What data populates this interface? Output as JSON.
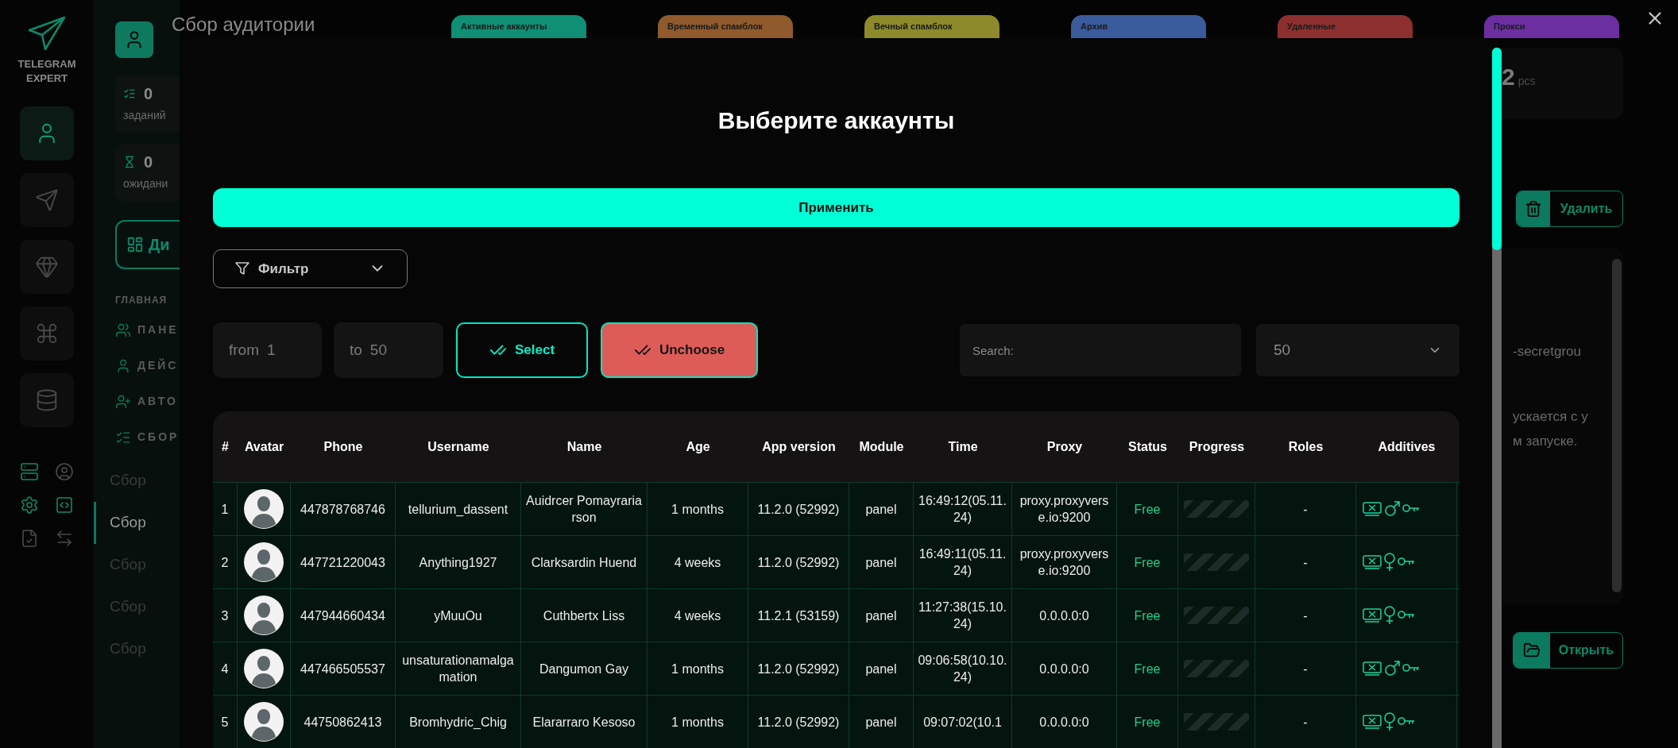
{
  "sidebar": {
    "logo_lines": [
      "TELEGRAM",
      "EXPERT"
    ],
    "nav": [
      {
        "kind": "user",
        "selected": true
      },
      {
        "kind": "send",
        "selected": false
      },
      {
        "kind": "diamond",
        "selected": false
      },
      {
        "kind": "command",
        "selected": false
      },
      {
        "kind": "database",
        "selected": false
      }
    ]
  },
  "header": {
    "title": "Сбор аудитории"
  },
  "status_tabs": [
    {
      "label": "Активные аккаунты",
      "color": "#0f8f74"
    },
    {
      "label": "Временный спамблок",
      "color": "#8f5a2c"
    },
    {
      "label": "Вечный спамблок",
      "color": "#8c8a2a"
    },
    {
      "label": "Архив",
      "color": "#3a5c9c"
    },
    {
      "label": "Удаленные",
      "color": "#8e2f2f"
    },
    {
      "label": "Прокси",
      "color": "#6b2fa0"
    }
  ],
  "stats": [
    {
      "kind": "tasks",
      "value": "0",
      "label": "заданий"
    },
    {
      "kind": "waiting",
      "value": "0",
      "label": "ожидани"
    }
  ],
  "dashboard_button": "Ди",
  "menu": {
    "section": "ГЛАВНАЯ",
    "items": [
      {
        "kind": "group",
        "label": "ПАНЕ"
      },
      {
        "kind": "user",
        "label": "ДЕЙС"
      },
      {
        "kind": "user-add",
        "label": "АВТО"
      },
      {
        "kind": "user-list",
        "label": "СБОР"
      }
    ],
    "subitems": [
      {
        "label": "Сбор",
        "selected": false
      },
      {
        "label": "Сбор",
        "selected": true
      },
      {
        "label": "Сбор",
        "selected": false
      },
      {
        "label": "Сбор",
        "selected": false
      },
      {
        "label": "Сбор",
        "selected": false
      }
    ]
  },
  "right_panel": {
    "count": "2",
    "unit": "pcs",
    "delete_button": "Удалить",
    "text_lines": [
      "-secretgrou",
      "ускается с у",
      "м запуске."
    ],
    "open_button": "Открыть"
  },
  "modal": {
    "title": "Выберите аккаунты",
    "apply_button": "Применить",
    "filter": {
      "label": "Фильтр"
    },
    "range_from": {
      "prefix": "from",
      "value": "1"
    },
    "range_to": {
      "prefix": "to",
      "value": "50"
    },
    "select_button": "Select",
    "unchoose_button": "Unchoose",
    "search": {
      "placeholder": "Search:"
    },
    "page_size": "50",
    "table": {
      "columns": [
        "#",
        "Avatar",
        "Phone",
        "Username",
        "Name",
        "Age",
        "App version",
        "Module",
        "Time",
        "Proxy",
        "Status",
        "Progress",
        "Roles",
        "Additives"
      ],
      "rows": [
        {
          "index": "1",
          "phone": "447878768746",
          "username": "tellurium_dassent",
          "name": "Auidrcer Pomayrariarson",
          "age": "1 months",
          "app_version": "11.2.0 (52992)",
          "module": "panel",
          "time": "16:49:12(05.11.24)",
          "proxy": "proxy.proxyverse.io:9200",
          "status": "Free",
          "roles": "-",
          "kind": "male",
          "level": 0
        },
        {
          "index": "2",
          "phone": "447721220043",
          "username": "Anything1927",
          "name": "Clarksardin Huend",
          "age": "4 weeks",
          "app_version": "11.2.0 (52992)",
          "module": "panel",
          "time": "16:49:11(05.11.24)",
          "proxy": "proxy.proxyverse.io:9200",
          "status": "Free",
          "roles": "-",
          "kind": "female",
          "level": 0
        },
        {
          "index": "3",
          "phone": "447944660434",
          "username": "yMuuOu",
          "name": "Cuthbertx Liss",
          "age": "4 weeks",
          "app_version": "11.2.1 (53159)",
          "module": "panel",
          "time": "11:27:38(15.10.24)",
          "proxy": "0.0.0.0:0",
          "status": "Free",
          "roles": "-",
          "kind": "female",
          "level": 0
        },
        {
          "index": "4",
          "phone": "447466505537",
          "username": "unsaturationamalgamation",
          "name": "Dangumon Gay",
          "age": "1 months",
          "app_version": "11.2.0 (52992)",
          "module": "panel",
          "time": "09:06:58(10.10.24)",
          "proxy": "0.0.0.0:0",
          "status": "Free",
          "roles": "-",
          "kind": "male",
          "level": 0
        },
        {
          "index": "5",
          "phone": "44750862413",
          "username": "Bromhydric_Chig",
          "name": "Elararraro Kesoso",
          "age": "1 months",
          "app_version": "11.2.0 (52992)",
          "module": "panel",
          "time": "09:07:02(10.1",
          "proxy": "0.0.0.0:0",
          "status": "Free",
          "roles": "-",
          "kind": "female",
          "level": 0
        }
      ]
    }
  }
}
